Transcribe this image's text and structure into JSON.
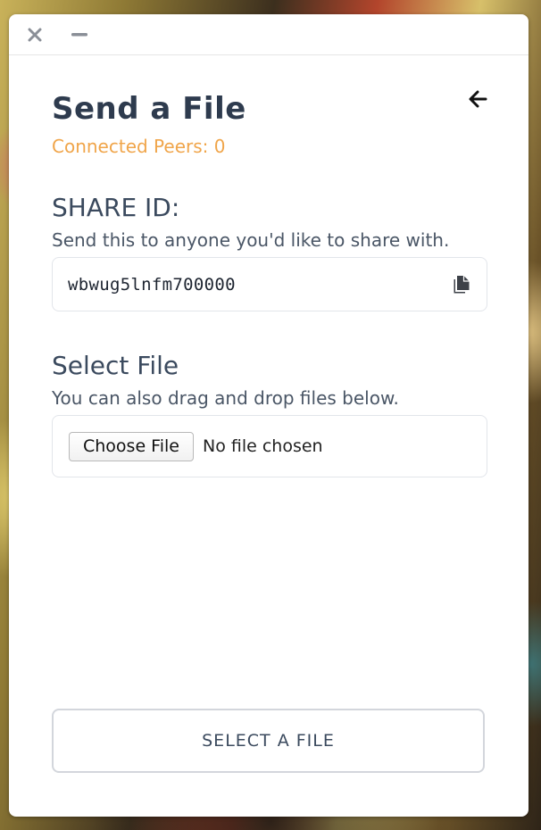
{
  "window": {
    "close_icon": "close-icon",
    "minimize_icon": "minimize-icon",
    "back_icon": "arrow-left-icon"
  },
  "page": {
    "title": "Send a File",
    "connected_peers_text": "Connected Peers: 0"
  },
  "share": {
    "heading": "SHARE ID:",
    "description": "Send this to anyone you'd like to share with.",
    "id_value": "wbwug5lnfm700000",
    "copy_icon": "copy-icon"
  },
  "select_file": {
    "heading": "Select File",
    "description": "You can also drag and drop files below.",
    "choose_button_label": "Choose File",
    "status_text": "No file chosen"
  },
  "actions": {
    "select_button_label": "SELECT A FILE"
  },
  "colors": {
    "accent_orange": "#f0a54a",
    "heading_dark": "#2e3b4e",
    "border": "#e2e5ea"
  }
}
